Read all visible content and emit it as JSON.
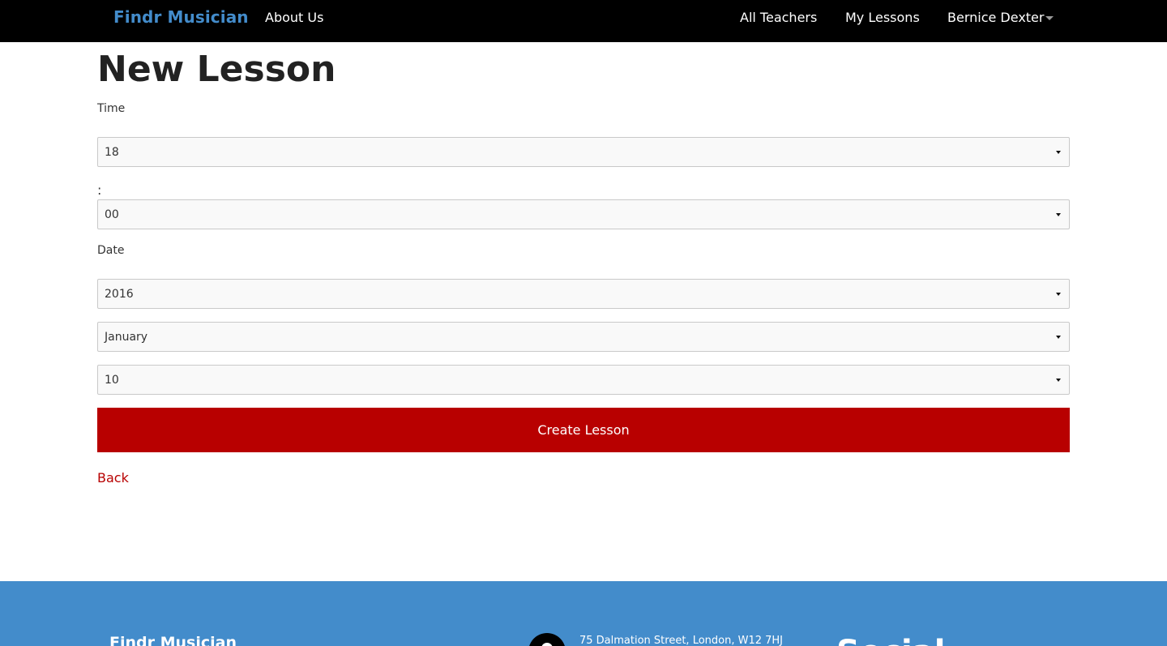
{
  "navbar": {
    "brand": "Findr Musician",
    "about": "About Us",
    "all_teachers": "All Teachers",
    "my_lessons": "My Lessons",
    "user_name": "Bernice Dexter",
    "brand_color": "#438ccb",
    "background": "#000000"
  },
  "form": {
    "title": "New Lesson",
    "time_label": "Time",
    "hour_value": "18",
    "colon": ":",
    "minute_value": "00",
    "date_label": "Date",
    "year_value": "2016",
    "month_value": "January",
    "day_value": "10",
    "submit_label": "Create Lesson",
    "submit_color": "#b80000",
    "back_label": "Back"
  },
  "footer": {
    "brand": "Findr Musician",
    "address": "75 Dalmation Street, London, W12 7HJ",
    "social_heading": "Social",
    "background": "#438ccb",
    "icons": [
      "map-pin-icon"
    ]
  }
}
